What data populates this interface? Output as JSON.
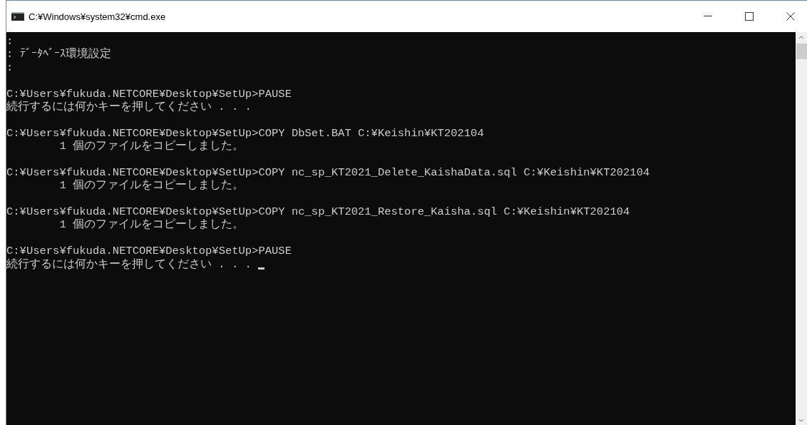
{
  "window": {
    "title": "C:¥Windows¥system32¥cmd.exe"
  },
  "console": {
    "blocks": [
      {
        "lines": [
          {
            "text": ":"
          },
          {
            "text": ": ﾃﾞｰﾀﾍﾞｰｽ環境設定"
          },
          {
            "text": ":"
          }
        ]
      },
      {
        "lines": [
          {
            "text": "C:¥Users¥fukuda.NETCORE¥Desktop¥SetUp>PAUSE"
          },
          {
            "text": "続行するには何かキーを押してください . . ."
          }
        ]
      },
      {
        "lines": [
          {
            "text": "C:¥Users¥fukuda.NETCORE¥Desktop¥SetUp>COPY DbSet.BAT C:¥Keishin¥KT202104"
          },
          {
            "text": "        1 個のファイルをコピーしました。"
          }
        ]
      },
      {
        "lines": [
          {
            "text": "C:¥Users¥fukuda.NETCORE¥Desktop¥SetUp>COPY nc_sp_KT2021_Delete_KaishaData.sql C:¥Keishin¥KT202104"
          },
          {
            "text": "        1 個のファイルをコピーしました。"
          }
        ]
      },
      {
        "lines": [
          {
            "text": "C:¥Users¥fukuda.NETCORE¥Desktop¥SetUp>COPY nc_sp_KT2021_Restore_Kaisha.sql C:¥Keishin¥KT202104"
          },
          {
            "text": "        1 個のファイルをコピーしました。"
          }
        ]
      },
      {
        "lines": [
          {
            "text": "C:¥Users¥fukuda.NETCORE¥Desktop¥SetUp>PAUSE"
          },
          {
            "text": "続行するには何かキーを押してください . . .",
            "cursor": true
          }
        ]
      }
    ]
  }
}
